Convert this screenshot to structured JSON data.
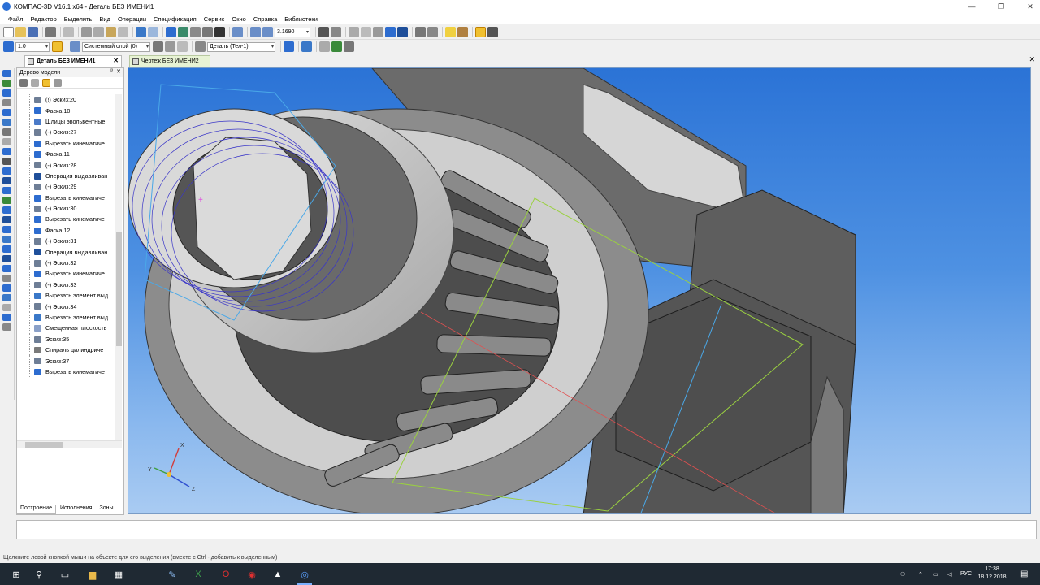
{
  "window": {
    "title": "КОМПАС-3D V16.1 x64 - Деталь БЕЗ ИМЕНИ1",
    "controls": {
      "minimize": "—",
      "maximize": "❐",
      "close": "✕"
    }
  },
  "menu": [
    "Файл",
    "Редактор",
    "Выделить",
    "Вид",
    "Операции",
    "Спецификация",
    "Сервис",
    "Окно",
    "Справка",
    "Библиотеки"
  ],
  "toolbar1": {
    "zoom_value": "3.1690"
  },
  "toolbar2": {
    "step_value": "1.0",
    "layer_value": "Системный слой (0)",
    "body_value": "Деталь (Тел-1)"
  },
  "tabs": [
    {
      "label": "Деталь БЕЗ ИМЕНИ1",
      "active": true
    },
    {
      "label": "Чертеж БЕЗ ИМЕНИ2",
      "active": false
    }
  ],
  "tree": {
    "title": "Дерево модели",
    "pin": "ᵖ",
    "close": "✕",
    "items": [
      {
        "label": "(!) Эскиз:20",
        "icon": "sketch-icon"
      },
      {
        "label": "Фаска:10",
        "icon": "chamfer-icon"
      },
      {
        "label": "Шлицы эвольвентные",
        "icon": "splines-icon"
      },
      {
        "label": "(-) Эскиз:27",
        "icon": "sketch-icon"
      },
      {
        "label": "Вырезать кинематиче",
        "icon": "cut-sweep-icon"
      },
      {
        "label": "Фаска:11",
        "icon": "chamfer-icon"
      },
      {
        "label": "(-) Эскиз:28",
        "icon": "sketch-icon"
      },
      {
        "label": "Операция выдавливан",
        "icon": "extrude-icon"
      },
      {
        "label": "(-) Эскиз:29",
        "icon": "sketch-icon"
      },
      {
        "label": "Вырезать кинематиче",
        "icon": "cut-sweep-icon"
      },
      {
        "label": "(-) Эскиз:30",
        "icon": "sketch-icon"
      },
      {
        "label": "Вырезать кинематиче",
        "icon": "cut-sweep-icon"
      },
      {
        "label": "Фаска:12",
        "icon": "chamfer-icon"
      },
      {
        "label": "(-) Эскиз:31",
        "icon": "sketch-icon"
      },
      {
        "label": "Операция выдавливан",
        "icon": "extrude-icon"
      },
      {
        "label": "(-) Эскиз:32",
        "icon": "sketch-icon"
      },
      {
        "label": "Вырезать кинематиче",
        "icon": "cut-sweep-icon"
      },
      {
        "label": "(-) Эскиз:33",
        "icon": "sketch-icon"
      },
      {
        "label": "Вырезать элемент выд",
        "icon": "cut-extrude-icon"
      },
      {
        "label": "(-) Эскиз:34",
        "icon": "sketch-icon"
      },
      {
        "label": "Вырезать элемент выд",
        "icon": "cut-extrude-icon"
      },
      {
        "label": "Смещенная плоскость",
        "icon": "plane-icon"
      },
      {
        "label": "Эскиз:35",
        "icon": "sketch-icon"
      },
      {
        "label": "Спираль цилиндриче",
        "icon": "helix-icon"
      },
      {
        "label": "Эскиз:37",
        "icon": "sketch-icon"
      },
      {
        "label": "Вырезать кинематиче",
        "icon": "cut-sweep-icon"
      }
    ]
  },
  "bottom_tabs": [
    "Построение",
    "Исполнения",
    "Зоны"
  ],
  "axes": {
    "x": "X",
    "y": "Y",
    "z": "Z"
  },
  "status": "Щелкните левой кнопкой мыши на объекте для его выделения (вместе с Ctrl - добавить к выделенным)",
  "taskbar": {
    "lang": "РУС",
    "time": "17:38",
    "date": "18.12.2018"
  },
  "colors": {
    "viewport_top": "#2b73d6",
    "viewport_bottom": "#a9cbf2",
    "part_dark": "#5a5a5a",
    "part_light": "#d2d2d2",
    "taskbar": "#1f2933"
  }
}
